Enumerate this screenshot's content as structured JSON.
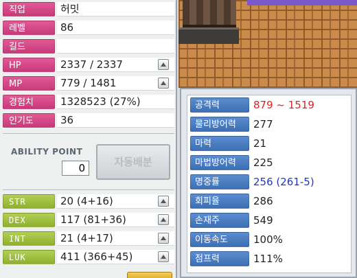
{
  "stats": {
    "job_label": "직업",
    "job": "허밋",
    "level_label": "레벨",
    "level": "86",
    "guild_label": "길드",
    "guild": "",
    "hp_label": "HP",
    "hp": "2337 / 2337",
    "mp_label": "MP",
    "mp": "779 / 1481",
    "exp_label": "경험치",
    "exp": "1328523 (27%)",
    "fame_label": "인기도",
    "fame": "36"
  },
  "ability": {
    "title": "ABILITY POINT",
    "points": "0",
    "auto_assign_label": "자동배분"
  },
  "attributes": [
    {
      "label": "STR",
      "value": "20 (4+16)"
    },
    {
      "label": "DEX",
      "value": "117 (81+36)"
    },
    {
      "label": "INT",
      "value": "21 (4+17)"
    },
    {
      "label": "LUK",
      "value": "411 (366+45)"
    }
  ],
  "details": [
    {
      "label": "공격력",
      "value": "879 ~ 1519"
    },
    {
      "label": "물리방어력",
      "value": "277"
    },
    {
      "label": "마력",
      "value": "21"
    },
    {
      "label": "마법방어력",
      "value": "225"
    },
    {
      "label": "명중률",
      "value": "256 (261-5)"
    },
    {
      "label": "회피율",
      "value": "286"
    },
    {
      "label": "손재주",
      "value": "549"
    },
    {
      "label": "이동속도",
      "value": "100%"
    },
    {
      "label": "점프력",
      "value": "111%"
    }
  ],
  "colors": {
    "attack_value": "#e02020",
    "accuracy_value": "#2233cc",
    "label_pink": "#d04a88",
    "label_green": "#a2c046",
    "label_blue": "#4b7cc2"
  }
}
